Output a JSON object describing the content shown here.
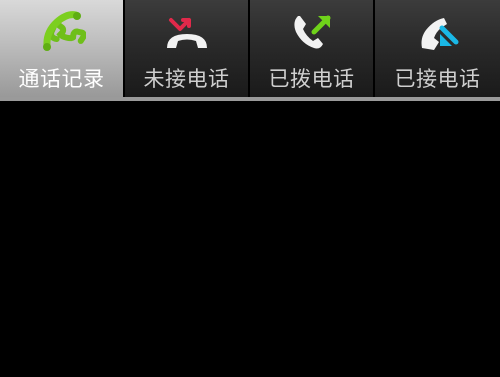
{
  "tabs": [
    {
      "label": "通话记录",
      "icon": "phone-handset-icon",
      "selected": true,
      "color": "#7ccf1f"
    },
    {
      "label": "未接电话",
      "icon": "missed-call-icon",
      "selected": false,
      "color": "#e0294a"
    },
    {
      "label": "已拨电话",
      "icon": "outgoing-call-icon",
      "selected": false,
      "color": "#6fd21a"
    },
    {
      "label": "已接电话",
      "icon": "incoming-call-icon",
      "selected": false,
      "color": "#1ab8e6"
    }
  ]
}
